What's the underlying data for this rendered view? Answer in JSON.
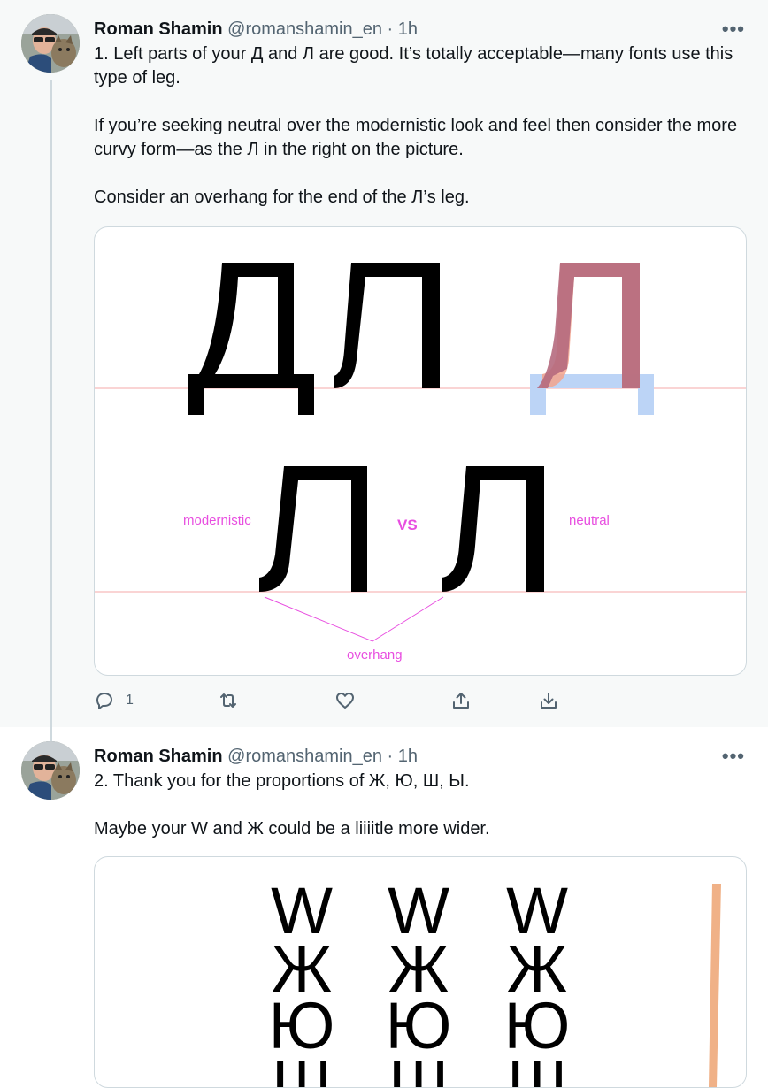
{
  "tweets": [
    {
      "author": "Roman Shamin",
      "handle": "@romanshamin_en",
      "separator": " · ",
      "time": "1h",
      "more": "•••",
      "paragraphs": [
        "1. Left parts of your Д and Л are good. It’s totally acceptable—many fonts use this type of leg.",
        "If you’re seeking neutral over the modernistic look and feel then consider the more curvy form—as the Л in the right on the picture.",
        "Consider an overhang for the end of the Л’s leg."
      ],
      "image": {
        "glyphs_top": [
          "Д",
          "Л"
        ],
        "overlay_glyph": "Л",
        "bottom_glyphs": [
          "Л",
          "Л"
        ],
        "label_left": "modernistic",
        "label_vs": "VS",
        "label_right": "neutral",
        "label_overhang": "overhang"
      },
      "actions": {
        "reply_count": "1",
        "repost_count": "",
        "like_count": ""
      }
    },
    {
      "author": "Roman Shamin",
      "handle": "@romanshamin_en",
      "separator": " · ",
      "time": "1h",
      "more": "•••",
      "paragraphs": [
        "2. Thank you for the proportions of Ж, Ю, Ш, Ы.",
        "Maybe your W and Ж could be a liiiitle more wider."
      ],
      "image": {
        "columns": [
          [
            "W",
            "Ж",
            "Ю",
            "Ш"
          ],
          [
            "W",
            "Ж",
            "Ю",
            "Ш"
          ],
          [
            "W",
            "Ж",
            "Ю",
            "Ш"
          ]
        ]
      }
    }
  ],
  "colors": {
    "guide_line": "#f4a9a9",
    "label_pink": "#e84ee0",
    "overlay_red": "#b56a7e",
    "overlay_blue": "#bcd4f6",
    "bar_orange": "#f0b187"
  }
}
